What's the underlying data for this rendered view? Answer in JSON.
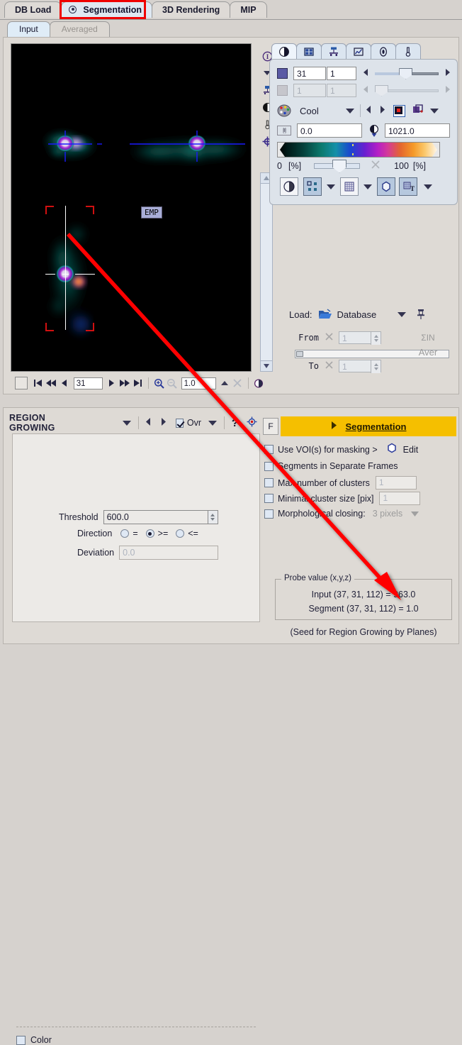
{
  "window": {
    "main_tabs": [
      {
        "label": "DB Load",
        "selected": false,
        "icon": null
      },
      {
        "label": "Segmentation",
        "selected": true,
        "icon": "radio-target-icon",
        "highlighted": true
      },
      {
        "label": "3D Rendering",
        "selected": false,
        "icon": null
      },
      {
        "label": "MIP",
        "selected": false,
        "icon": null
      }
    ],
    "sub_tabs": [
      {
        "label": "Input",
        "selected": true,
        "enabled": true
      },
      {
        "label": "Averaged",
        "selected": false,
        "enabled": false
      }
    ]
  },
  "viewer": {
    "overlay_label": "EMP",
    "toolbar": {
      "slice_value": "31",
      "zoom_value": "1.0",
      "icons": [
        "checkbox-icon",
        "first-frame-icon",
        "rewind-icon",
        "step-back-icon",
        "step-forward-icon",
        "fast-forward-icon",
        "last-frame-icon",
        "zoom-in-icon",
        "zoom-out-icon",
        "up-arrow-icon",
        "close-icon",
        "contrast-icon"
      ]
    },
    "side_icons": [
      "info-icon",
      "chevron-down-icon",
      "layout-icon",
      "contrast-icon",
      "thermometer-icon",
      "crosshair-icon"
    ]
  },
  "control_panel": {
    "tabs": [
      {
        "icon": "contrast-icon",
        "selected": true
      },
      {
        "icon": "layout-grid-icon",
        "selected": false
      },
      {
        "icon": "projector-icon",
        "selected": false
      },
      {
        "icon": "chart-icon",
        "selected": false
      },
      {
        "icon": "waves-icon",
        "selected": false
      },
      {
        "icon": "thermometer-icon",
        "selected": false
      }
    ],
    "row1": {
      "field_a": "31",
      "field_b": "1",
      "slider_pct": 44,
      "enabled": true
    },
    "row2": {
      "field_a": "1",
      "field_b": "1",
      "slider_pct": 5,
      "enabled": false
    },
    "colormap": {
      "name": "Cool",
      "palette_icon": "palette-icon"
    },
    "range": {
      "min": "0.0",
      "max": "1021.0",
      "min_icon": "min-range-icon",
      "max_icon": "max-threshold-icon"
    },
    "colorbar": {
      "left_label": "0",
      "left_unit": "[%]",
      "right_label": "100",
      "right_unit": "[%]",
      "slider_pct": 38
    },
    "button_row": [
      {
        "icon": "alpha-blend-icon",
        "active": false
      },
      {
        "icon": "scatter-overlay-icon",
        "active": true
      },
      {
        "icon": "grid-overlay-icon",
        "active": false
      },
      {
        "icon": "iso-contour-icon",
        "active": true
      },
      {
        "icon": "annotation-icon",
        "active": true
      }
    ]
  },
  "load_section": {
    "label": "Load:",
    "source": "Database",
    "folder_icon": "open-folder-icon",
    "pin_icon": "pin-icon",
    "from_label": "From",
    "from_value": "1",
    "to_label": "To",
    "to_value": "1",
    "sum_label": "ΣIN",
    "aver_label": "Aver"
  },
  "region_growing": {
    "title": "REGION GROWING",
    "ovr_label": "Ovr",
    "ovr_checked": true,
    "help_icon": "question-mark-icon",
    "target_icon": "target-icon",
    "threshold_label": "Threshold",
    "threshold_value": "600.0",
    "direction_label": "Direction",
    "direction_options": [
      {
        "label": "=",
        "selected": false
      },
      {
        "label": ">=",
        "selected": true
      },
      {
        "label": "<=",
        "selected": false
      }
    ],
    "deviation_label": "Deviation",
    "deviation_value": "0.0",
    "color_label": "Color",
    "color_checked": false
  },
  "segmentation": {
    "f_button": "F",
    "run_label": "Segmentation",
    "options": [
      {
        "label": "Use VOI(s) for masking >",
        "checked": false,
        "enabled": true,
        "extra": {
          "type": "radio-button",
          "label": "Edit"
        }
      },
      {
        "label": "Segments in Separate Frames",
        "checked": false,
        "enabled": true
      },
      {
        "label": "Max number of clusters",
        "checked": false,
        "enabled": true,
        "field": "1"
      },
      {
        "label": "Minimal cluster size [pix]",
        "checked": false,
        "enabled": true,
        "field": "1"
      },
      {
        "label": "Morphological closing:",
        "checked": false,
        "enabled": true,
        "select": "3 pixels"
      }
    ]
  },
  "probe": {
    "legend": "Probe value (x,y,z)",
    "line1": "Input (37, 31, 112) = 963.0",
    "line2": "Segment (37, 31, 112) = 1.0",
    "note": "(Seed for Region Growing by Planes)"
  },
  "colors": {
    "accent_yellow": "#f5bf00",
    "highlight_red": "#ef0000",
    "panel_bg": "#dedad5",
    "window_bg": "#d6d2ce",
    "tab_selected": "#dfe8f2"
  }
}
